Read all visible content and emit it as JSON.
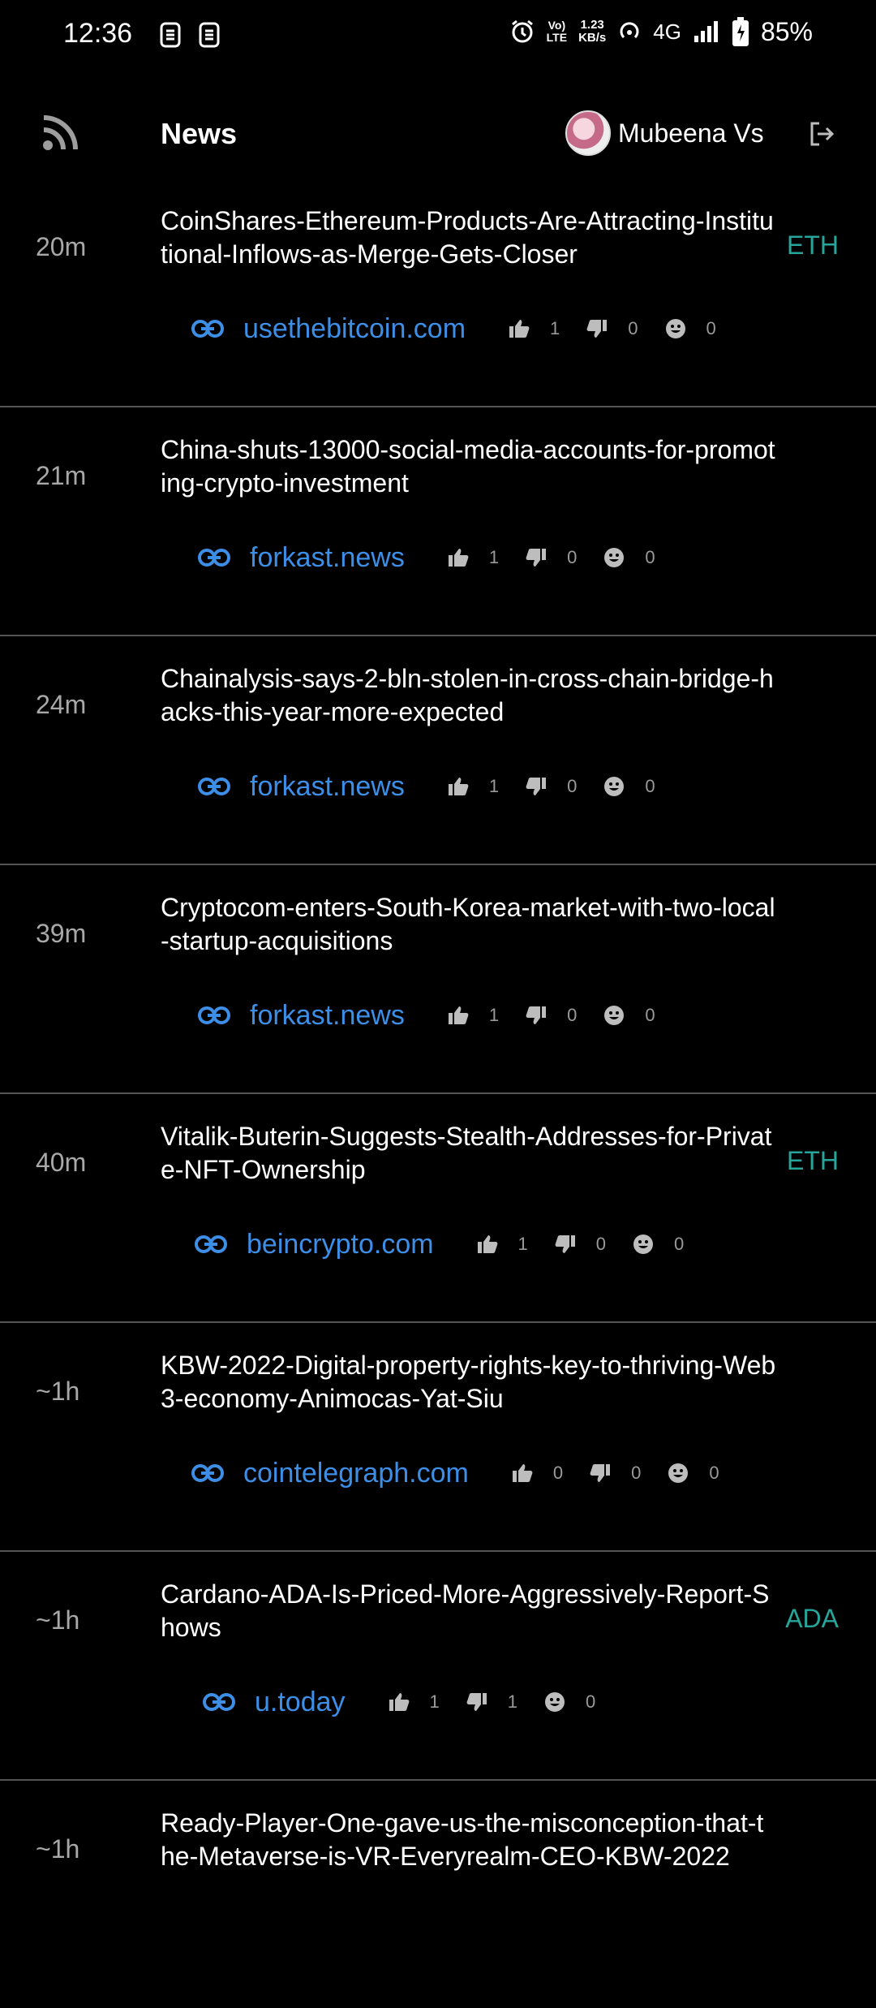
{
  "status_bar": {
    "time": "12:36",
    "network_speed_value": "1.23",
    "network_speed_unit": "KB/s",
    "volte_top": "Vo)",
    "volte_bottom": "LTE",
    "network_type": "4G",
    "battery": "85%"
  },
  "header": {
    "title": "News",
    "user_name": "Mubeena Vs"
  },
  "colors": {
    "background": "#000000",
    "link": "#3d8ee6",
    "tag": "#26a69a",
    "time": "#a8a8a8",
    "divider": "#555555"
  },
  "news": [
    {
      "time": "20m",
      "title": "CoinShares-Ethereum-Products-Are-Attracting-Institutional-Inflows-as-Merge-Gets-Closer",
      "tag": "ETH",
      "source": "usethebitcoin.com",
      "likes": "1",
      "dislikes": "0",
      "emoji": "0"
    },
    {
      "time": "21m",
      "title": "China-shuts-13000-social-media-accounts-for-promoting-crypto-investment",
      "tag": "",
      "source": "forkast.news",
      "likes": "1",
      "dislikes": "0",
      "emoji": "0"
    },
    {
      "time": "24m",
      "title": "Chainalysis-says-2-bln-stolen-in-cross-chain-bridge-hacks-this-year-more-expected",
      "tag": "",
      "source": "forkast.news",
      "likes": "1",
      "dislikes": "0",
      "emoji": "0"
    },
    {
      "time": "39m",
      "title": "Cryptocom-enters-South-Korea-market-with-two-local-startup-acquisitions",
      "tag": "",
      "source": "forkast.news",
      "likes": "1",
      "dislikes": "0",
      "emoji": "0"
    },
    {
      "time": "40m",
      "title": "Vitalik-Buterin-Suggests-Stealth-Addresses-for-Private-NFT-Ownership",
      "tag": "ETH",
      "source": "beincrypto.com",
      "likes": "1",
      "dislikes": "0",
      "emoji": "0"
    },
    {
      "time": "~1h",
      "title": "KBW-2022-Digital-property-rights-key-to-thriving-Web3-economy-Animocas-Yat-Siu",
      "tag": "",
      "source": "cointelegraph.com",
      "likes": "0",
      "dislikes": "0",
      "emoji": "0"
    },
    {
      "time": "~1h",
      "title": "Cardano-ADA-Is-Priced-More-Aggressively-Report-Shows",
      "tag": "ADA",
      "source": "u.today",
      "likes": "1",
      "dislikes": "1",
      "emoji": "0"
    },
    {
      "time": "~1h",
      "title": "Ready-Player-One-gave-us-the-misconception-that-the-Metaverse-is-VR-Everyrealm-CEO-KBW-2022",
      "tag": "",
      "source": "",
      "likes": "",
      "dislikes": "",
      "emoji": ""
    }
  ]
}
